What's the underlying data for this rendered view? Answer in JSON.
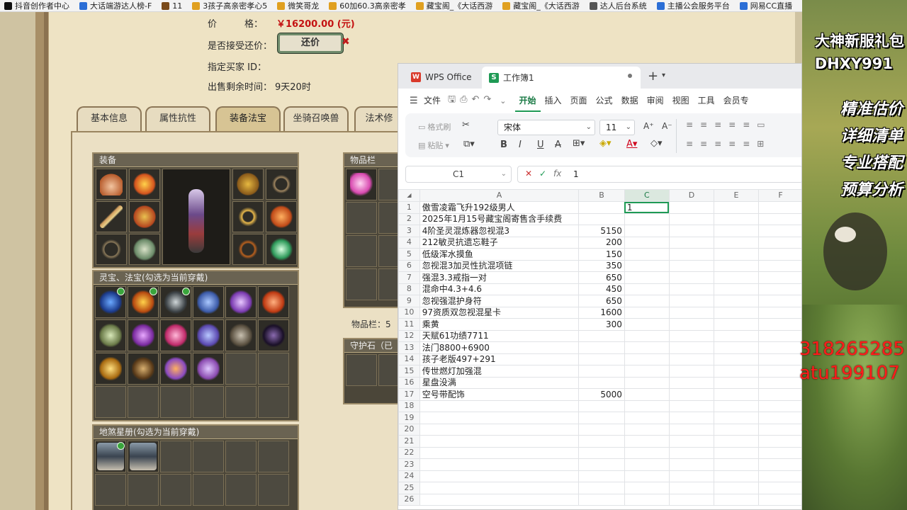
{
  "bookmarks": [
    {
      "label": "抖音创作者中心",
      "color": "#111111"
    },
    {
      "label": "大话端游达人榜-F",
      "color": "#2b6ed6"
    },
    {
      "label": "11",
      "color": "#7a4a1a"
    },
    {
      "label": "3孩子高亲密孝心5",
      "color": "#e0a020"
    },
    {
      "label": "微笑哥龙",
      "color": "#e0a020"
    },
    {
      "label": "60加60.3高亲密孝",
      "color": "#e0a020"
    },
    {
      "label": "藏宝阁_《大话西游",
      "color": "#e0a020"
    },
    {
      "label": "藏宝阁_《大话西游",
      "color": "#e0a020"
    },
    {
      "label": "达人后台系统",
      "color": "#555555"
    },
    {
      "label": "主播公会服务平台",
      "color": "#2b6ed6"
    },
    {
      "label": "网易CC直播",
      "color": "#2b6ed6"
    }
  ],
  "game": {
    "price_label": "价　　　格：",
    "price_value": "￥16200.00 (元)",
    "counter_label": "是否接受还价：",
    "counter_button": "还价",
    "buyer_label": "指定买家 ID：",
    "remaining_label": "出售剩余时间：",
    "remaining_value": "9天20时",
    "tabs": [
      "基本信息",
      "属性抗性",
      "装备法宝",
      "坐骑召唤兽",
      "法术修"
    ],
    "equip_title": "装备",
    "lingbao_title": "灵宝、法宝(勾选为当前穿戴)",
    "disha_title": "地煞星册(勾选为当前穿戴)",
    "inventory_title": "物品栏",
    "inventory_count": "物品栏：5",
    "guard_title": "守护石（已"
  },
  "wps": {
    "tab_home": "WPS Office",
    "tab_doc": "工作簿1",
    "menu": [
      "文件",
      "开始",
      "插入",
      "页面",
      "公式",
      "数据",
      "审阅",
      "视图",
      "工具",
      "会员专"
    ],
    "active_menu": "开始",
    "format_brush": "格式刷",
    "paste": "粘贴",
    "font_name": "宋体",
    "font_size": "11",
    "cell_ref": "C1",
    "formula_value": "1",
    "columns": [
      "A",
      "B",
      "C",
      "D",
      "E",
      "F"
    ],
    "rows": [
      {
        "n": "1",
        "a": "傲雪凌霜飞升192级男人",
        "b": "",
        "c": "1"
      },
      {
        "n": "2",
        "a": "2025年1月15号藏宝阁寄售含手续费",
        "b": "",
        "c": ""
      },
      {
        "n": "3",
        "a": "4阶圣灵混炼器忽视混3",
        "b": "5150",
        "c": ""
      },
      {
        "n": "4",
        "a": "212敏灵抗遗忘鞋子",
        "b": "200",
        "c": ""
      },
      {
        "n": "5",
        "a": "低级浑水摸鱼",
        "b": "150",
        "c": ""
      },
      {
        "n": "6",
        "a": "忽视混3加灵性抗混项链",
        "b": "350",
        "c": ""
      },
      {
        "n": "7",
        "a": "强混3.3戒指一对",
        "b": "650",
        "c": ""
      },
      {
        "n": "8",
        "a": "混命中4.3+4.6",
        "b": "450",
        "c": ""
      },
      {
        "n": "9",
        "a": "忽视强混护身符",
        "b": "650",
        "c": ""
      },
      {
        "n": "10",
        "a": "97资质双忽视混星卡",
        "b": "1600",
        "c": ""
      },
      {
        "n": "11",
        "a": "乘黄",
        "b": "300",
        "c": ""
      },
      {
        "n": "12",
        "a": "天赋61功绩7711",
        "b": "",
        "c": ""
      },
      {
        "n": "13",
        "a": "法门8800+6900",
        "b": "",
        "c": ""
      },
      {
        "n": "14",
        "a": "孩子老版497+291",
        "b": "",
        "c": ""
      },
      {
        "n": "15",
        "a": "传世燃灯加强混",
        "b": "",
        "c": ""
      },
      {
        "n": "16",
        "a": "星盘没满",
        "b": "",
        "c": ""
      },
      {
        "n": "17",
        "a": "空号带配饰",
        "b": "5000",
        "c": ""
      },
      {
        "n": "18",
        "a": "",
        "b": "",
        "c": ""
      },
      {
        "n": "19",
        "a": "",
        "b": "",
        "c": ""
      },
      {
        "n": "20",
        "a": "",
        "b": "",
        "c": ""
      },
      {
        "n": "21",
        "a": "",
        "b": "",
        "c": ""
      },
      {
        "n": "22",
        "a": "",
        "b": "",
        "c": ""
      },
      {
        "n": "23",
        "a": "",
        "b": "",
        "c": ""
      },
      {
        "n": "24",
        "a": "",
        "b": "",
        "c": ""
      },
      {
        "n": "25",
        "a": "",
        "b": "",
        "c": ""
      },
      {
        "n": "26",
        "a": "",
        "b": "",
        "c": ""
      }
    ]
  },
  "promo": {
    "line1": "大神新服礼包",
    "line2": "DHXY991",
    "line3": "精准估价",
    "line4": "详细清单",
    "line5": "专业搭配",
    "line6": "预算分析",
    "overlay1": "318265285",
    "overlay2": "atu199107"
  }
}
